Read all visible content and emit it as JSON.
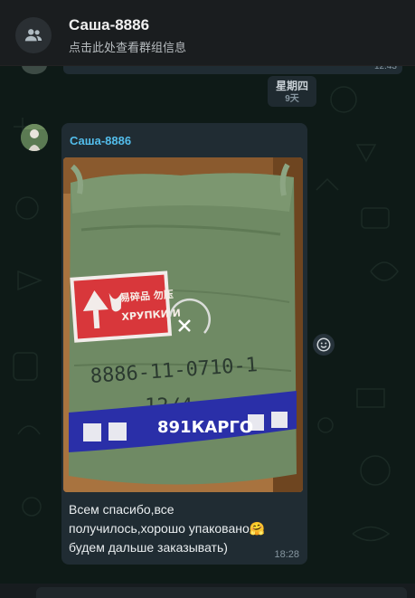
{
  "header": {
    "title": "Саша-8886",
    "subtitle": "点击此处查看群组信息",
    "avatar_icon": "group-icon"
  },
  "previous_message": {
    "time": "12:43"
  },
  "day_divider": {
    "label": "星期四",
    "sub": "9天"
  },
  "message": {
    "sender": "Саша-8886",
    "photo": {
      "sticker_text_cn": "易碎品 勿压",
      "sticker_text_ru": "ХРУПКИ И",
      "handwriting_line1": "8886-11-0710-1",
      "handwriting_line2": "12/4",
      "band_brand": "891КАРГО",
      "close_icon": "close-icon"
    },
    "text": "Всем спасибо,все\nполучилось,хорошо упаковано🤗\nбудем дальше заказывать)",
    "time": "18:28"
  },
  "reaction_button": {
    "icon": "emoji-icon"
  },
  "colors": {
    "header_bg": "#1a1d1f",
    "chat_bg": "#0e1a17",
    "bubble_bg": "#202c33",
    "sender_color": "#53bdeb",
    "band_blue": "#2a2fa8"
  }
}
